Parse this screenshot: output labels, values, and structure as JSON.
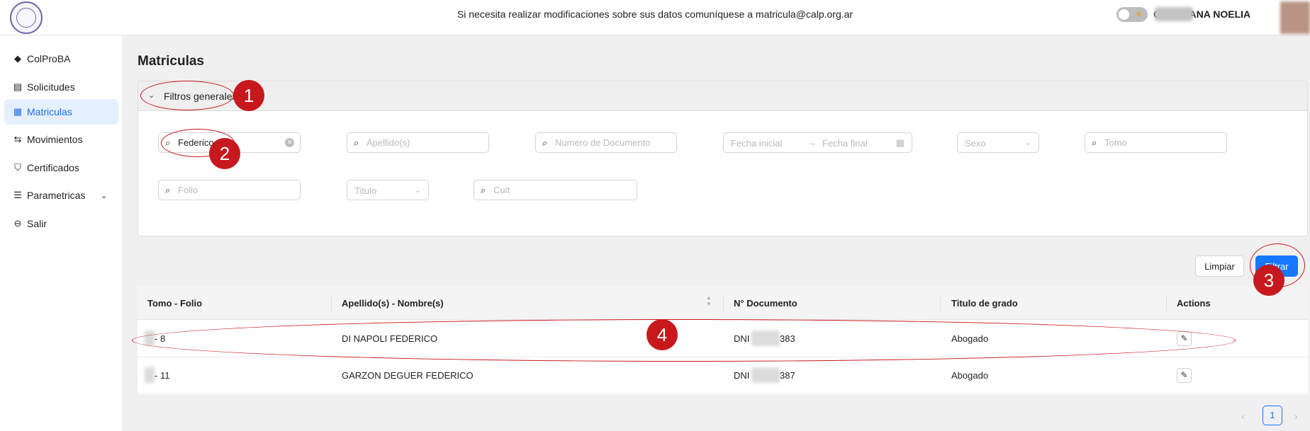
{
  "header": {
    "notice": "Si necesita realizar modificaciones sobre sus datos comuníquese a matricula@calp.org.ar",
    "user_name": "O MARIANA NOELIA",
    "toggle_icon": "sun-icon"
  },
  "sidebar": {
    "items": [
      {
        "label": "ColProBA",
        "icon": "colproba-icon",
        "glyph": "◆"
      },
      {
        "label": "Solicitudes",
        "icon": "document-icon",
        "glyph": "▤"
      },
      {
        "label": "Matriculas",
        "icon": "registry-icon",
        "glyph": "▦"
      },
      {
        "label": "Movimientos",
        "icon": "swap-icon",
        "glyph": "⇆"
      },
      {
        "label": "Certificados",
        "icon": "shield-icon",
        "glyph": "⛉"
      },
      {
        "label": "Parametricas",
        "icon": "list-icon",
        "glyph": "☰"
      },
      {
        "label": "Salir",
        "icon": "logout-icon",
        "glyph": "⊖"
      }
    ],
    "active_index": 2
  },
  "main": {
    "title": "Matriculas",
    "filters": {
      "section_title": "Filtros generales",
      "nombre_value": "Federico",
      "apellido_placeholder": "Apellido(s)",
      "documento_placeholder": "Numero de Documento",
      "fecha_inicial_placeholder": "Fecha inicial",
      "fecha_final_placeholder": "Fecha final",
      "sexo_placeholder": "Sexo",
      "tomo_placeholder": "Tomo",
      "folio_placeholder": "Folio",
      "titulo_placeholder": "Titulo",
      "cuit_placeholder": "Cuit"
    },
    "buttons": {
      "clear_label": "Limpiar",
      "filter_label": "Filtrar"
    },
    "table": {
      "headers": [
        "Tomo - Folio",
        "Apellido(s) - Nombre(s)",
        "N° Documento",
        "Titulo de grado",
        "Actions"
      ],
      "rows": [
        {
          "tomo_folio": "- 8",
          "nombre": "DI NAPOLI FEDERICO",
          "doc_prefix": "DNI",
          "doc_suffix": "383",
          "titulo": "Abogado"
        },
        {
          "tomo_folio": "- 11",
          "nombre": "GARZON DEGUER FEDERICO",
          "doc_prefix": "DNI",
          "doc_suffix": "387",
          "titulo": "Abogado"
        }
      ]
    },
    "pagination": {
      "current_page": "1"
    }
  },
  "annotations": [
    "1",
    "2",
    "3",
    "4"
  ],
  "colors": {
    "accent": "#1677ff",
    "annotation": "#c7181d",
    "active_bg": "#e4f0fd"
  }
}
